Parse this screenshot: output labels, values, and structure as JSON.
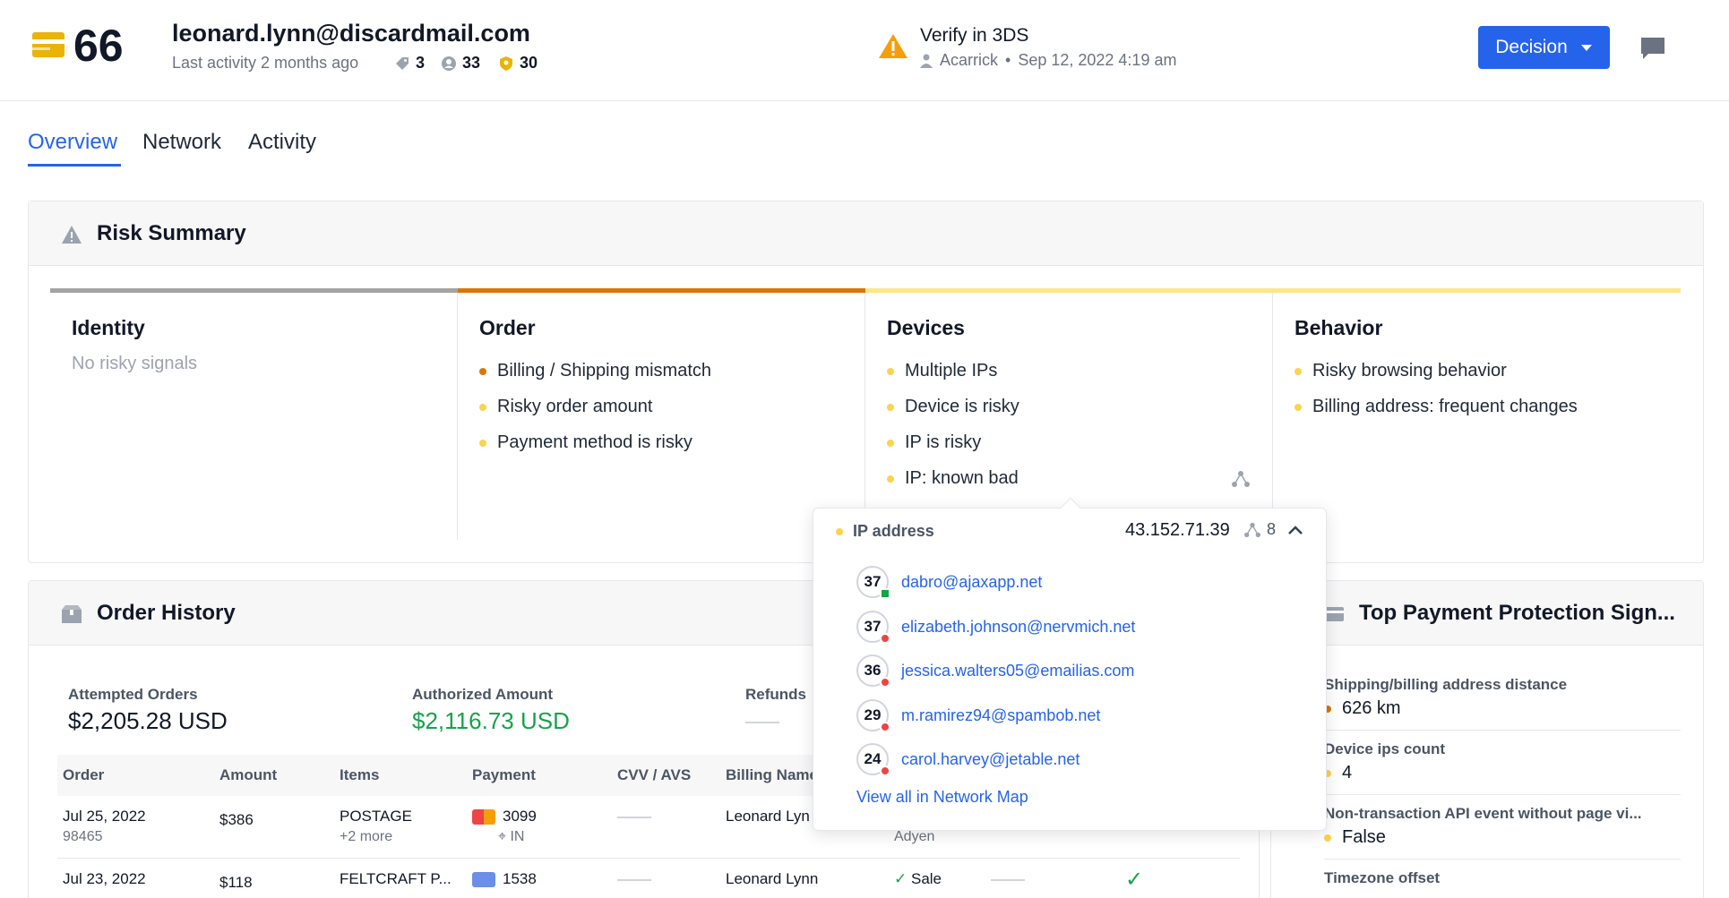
{
  "header": {
    "score": "66",
    "email": "leonard.lynn@discardmail.com",
    "last_activity": "Last activity 2 months ago",
    "stats": [
      {
        "icon": "tag-icon",
        "value": "3"
      },
      {
        "icon": "user-circle-icon",
        "value": "33"
      },
      {
        "icon": "shield-icon",
        "value": "30"
      }
    ],
    "verify_title": "Verify in 3DS",
    "verify_user": "Acarrick",
    "verify_date": "Sep 12, 2022 4:19 am",
    "decision_label": "Decision"
  },
  "tabs": [
    "Overview",
    "Network",
    "Activity"
  ],
  "risk_summary": {
    "title": "Risk Summary",
    "columns": [
      {
        "title": "Identity",
        "empty": "No risky signals",
        "signals": [],
        "bar_color": "#a3a3a3"
      },
      {
        "title": "Order",
        "empty": "",
        "bar_color": "#d97706",
        "signals": [
          {
            "text": "Billing / Shipping mismatch",
            "color": "#d97706"
          },
          {
            "text": "Risky order amount",
            "color": "#fcd34d"
          },
          {
            "text": "Payment method is risky",
            "color": "#fcd34d"
          }
        ]
      },
      {
        "title": "Devices",
        "empty": "",
        "bar_color": "#fde68a",
        "signals": [
          {
            "text": "Multiple IPs",
            "color": "#fcd34d"
          },
          {
            "text": "Device is risky",
            "color": "#fcd34d"
          },
          {
            "text": "IP is risky",
            "color": "#fcd34d"
          },
          {
            "text": "IP: known bad",
            "color": "#fcd34d"
          }
        ]
      },
      {
        "title": "Behavior",
        "empty": "",
        "bar_color": "#fde68a",
        "signals": [
          {
            "text": "Risky browsing behavior",
            "color": "#fcd34d"
          },
          {
            "text": "Billing address: frequent changes",
            "color": "#fcd34d"
          }
        ]
      }
    ]
  },
  "order_history": {
    "title": "Order History",
    "metrics": [
      {
        "label": "Attempted Orders",
        "value": "$2,205.28 USD",
        "color": "#111827"
      },
      {
        "label": "Authorized Amount",
        "value": "$2,116.73 USD",
        "color": "#16a34a"
      },
      {
        "label": "Refunds",
        "value": "",
        "color": "#111827"
      }
    ],
    "columns": [
      "Order",
      "Amount",
      "Items",
      "Payment",
      "CVV / AVS",
      "Billing Name"
    ],
    "rows": [
      {
        "date": "Jul 25, 2022",
        "id": "98465",
        "amount": "$386",
        "item": "POSTAGE",
        "more": "+2 more",
        "card": "3099",
        "country": "IN",
        "billing": "Leonard Lyn",
        "processor": "Adyen",
        "status": ""
      },
      {
        "date": "Jul 23, 2022",
        "id": "",
        "amount": "$118",
        "item": "FELTCRAFT P...",
        "more": "",
        "card": "1538",
        "country": "",
        "billing": "Leonard Lynn",
        "processor": "",
        "status": "Sale"
      }
    ]
  },
  "top_payment": {
    "title": "Top Payment Protection Sign...",
    "items": [
      {
        "label": "Shipping/billing address distance",
        "value": "626 km",
        "color": "#d97706"
      },
      {
        "label": "Device ips count",
        "value": "4",
        "color": "#fcd34d"
      },
      {
        "label": "Non-transaction API event without page vi...",
        "value": "False",
        "color": "#fcd34d"
      },
      {
        "label": "Timezone offset",
        "value": "",
        "color": "#fcd34d"
      }
    ]
  },
  "popup": {
    "label": "IP address",
    "ip": "43.152.71.39",
    "count": "8",
    "entries": [
      {
        "score": "37",
        "email": "dabro@ajaxapp.net",
        "badge": "#16a34a",
        "badge_shape": "square"
      },
      {
        "score": "37",
        "email": "elizabeth.johnson@nervmich.net",
        "badge": "#ef4444",
        "badge_shape": "circle"
      },
      {
        "score": "36",
        "email": "jessica.walters05@emailias.com",
        "badge": "#ef4444",
        "badge_shape": "circle"
      },
      {
        "score": "29",
        "email": "m.ramirez94@spambob.net",
        "badge": "#ef4444",
        "badge_shape": "circle"
      },
      {
        "score": "24",
        "email": "carol.harvey@jetable.net",
        "badge": "#ef4444",
        "badge_shape": "circle"
      }
    ],
    "view_all": "View all in Network Map"
  }
}
